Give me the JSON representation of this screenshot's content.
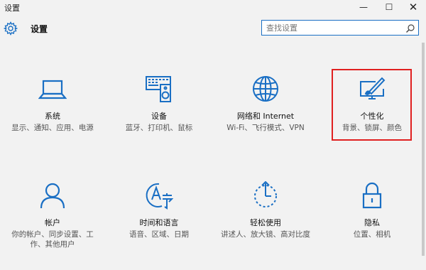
{
  "window": {
    "title": "设置",
    "minimize_glyph": "—",
    "maximize_glyph": "☐",
    "close_glyph": "✕"
  },
  "header": {
    "title": "设置",
    "icon": "gear-icon"
  },
  "search": {
    "placeholder": "查找设置",
    "icon": "search-icon"
  },
  "accent_color": "#1a6fc4",
  "highlight_color": "#e02020",
  "tiles": [
    {
      "id": "system",
      "name": "系统",
      "desc": "显示、通知、应用、电源",
      "icon": "laptop-icon"
    },
    {
      "id": "devices",
      "name": "设备",
      "desc": "蓝牙、打印机、鼠标",
      "icon": "devices-icon"
    },
    {
      "id": "network",
      "name": "网络和 Internet",
      "desc": "Wi-Fi、飞行模式、VPN",
      "icon": "globe-icon"
    },
    {
      "id": "personalization",
      "name": "个性化",
      "desc": "背景、锁屏、颜色",
      "icon": "paint-monitor-icon",
      "highlighted": true
    },
    {
      "id": "accounts",
      "name": "帐户",
      "desc": "你的帐户、同步设置、工作、其他用户",
      "icon": "person-icon"
    },
    {
      "id": "time-language",
      "name": "时间和语言",
      "desc": "语音、区域、日期",
      "icon": "time-language-icon"
    },
    {
      "id": "ease-of-access",
      "name": "轻松使用",
      "desc": "讲述人、放大镜、高对比度",
      "icon": "ease-of-access-icon"
    },
    {
      "id": "privacy",
      "name": "隐私",
      "desc": "位置、相机",
      "icon": "lock-icon"
    }
  ]
}
